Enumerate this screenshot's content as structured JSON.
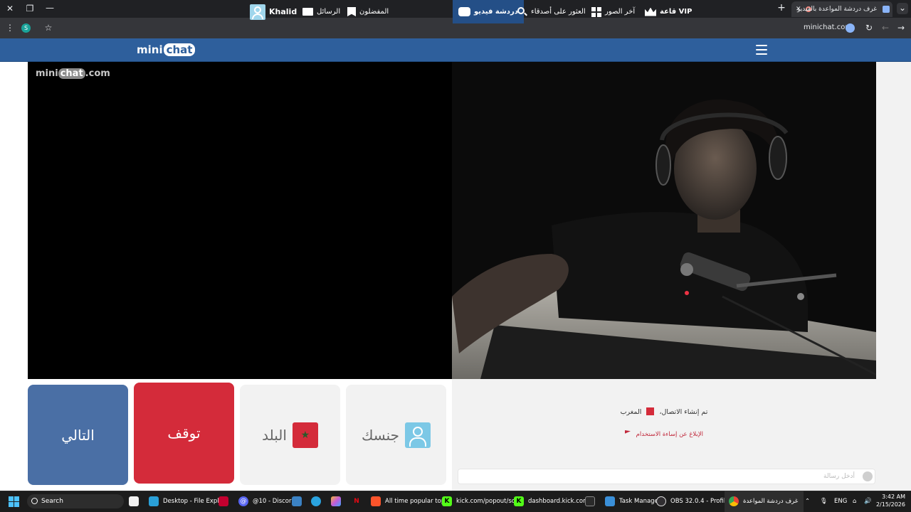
{
  "browser": {
    "tab_title": "غرف دردشة المواعدة بالفيديو",
    "new_tab": "+",
    "url": "minichat.com",
    "window_close": "✕",
    "window_restore": "❐",
    "window_minimize": "—",
    "tab_close": "✕",
    "tab_menu": "⌄",
    "profile_initial": "S"
  },
  "site": {
    "logo_main": "mini",
    "logo_bubble": "chat",
    "nav": {
      "username": "Khalid",
      "messages": "الرسائل",
      "favorites": "المفضلون",
      "video_chat": "دردشة فيديو",
      "find_friends": "العثور على أصدقاء",
      "latest_photos": "آخر الصور",
      "vip": "قاعة VIP"
    },
    "watermark": {
      "main": "mini",
      "bubble": "chat",
      "suffix": ".com"
    }
  },
  "controls": {
    "next": "التالي",
    "stop": "توقف",
    "country": "البلد",
    "gender": "جنسك"
  },
  "chat": {
    "connection_text": "تم إنشاء الاتصال،",
    "country_name": "المغرب",
    "report_link": "الإبلاغ عن إساءة الاستخدام",
    "input_placeholder": "أدخل رسالة"
  },
  "taskbar": {
    "search": "Search",
    "items": [
      "Desktop - File Explc",
      "@10 - Discor",
      "All time popular top",
      "kick.com/popout/sc",
      "dashboard.kick.com,",
      "Task Manage",
      "OBS 32.0.4 - Profile:",
      "غرف دردشة المواعدة"
    ],
    "discord_badge": "@",
    "lang": "ENG",
    "time": "3:42 AM",
    "date": "2/15/2026"
  },
  "colors": {
    "nav_bg": "#2e5f9c",
    "next_btn": "#4a6fa5",
    "stop_btn": "#d42b3a",
    "flag": "#d42b3a",
    "gender_tile": "#7cc8e6",
    "report_link": "#c0273a"
  },
  "icons": {
    "username": "avatar-icon",
    "messages": "envelope-icon",
    "favorites": "bookmark-icon",
    "video_chat": "video-chat-icon",
    "find_friends": "search-icon",
    "latest_photos": "grid-icon",
    "vip": "crown-icon",
    "menu": "hamburger-icon",
    "report": "flag-icon",
    "emoji": "emoji-icon"
  }
}
